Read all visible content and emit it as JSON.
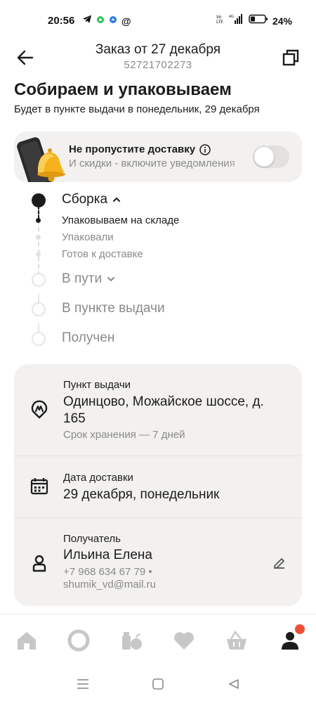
{
  "status_bar": {
    "time": "20:56",
    "battery": "24%",
    "icons_left": [
      "telegram-icon",
      "green-dot-icon",
      "blue-app-icon",
      "at-icon"
    ],
    "icons_right": [
      "volte-icon",
      "signal-icon",
      "battery-icon"
    ]
  },
  "header": {
    "title": "Заказ от 27 декабря",
    "order_number": "52721702273"
  },
  "status": {
    "heading": "Собираем и упаковываем",
    "subheading": "Будет в пункте выдачи в понедельник, 29 декабря"
  },
  "notification": {
    "title": "Не пропустите доставку",
    "text": "И скидки - включите уведомления",
    "toggle_on": false
  },
  "timeline": {
    "steps": [
      {
        "label": "Сборка",
        "state": "active",
        "expanded": true
      },
      {
        "label": "В пути",
        "state": "pending",
        "expanded": false
      },
      {
        "label": "В пункте выдачи",
        "state": "pending"
      },
      {
        "label": "Получен",
        "state": "pending"
      }
    ],
    "substeps": [
      {
        "label": "Упаковываем на складе",
        "state": "active"
      },
      {
        "label": "Упаковали",
        "state": "pending"
      },
      {
        "label": "Готов к доставке",
        "state": "pending"
      }
    ]
  },
  "details": {
    "pickup": {
      "label": "Пункт выдачи",
      "address": "Одинцово, Можайское шоссе, д. 165",
      "storage_note": "Срок хранения — 7 дней"
    },
    "delivery": {
      "label": "Дата доставки",
      "date": "29 декабря, понедельник"
    },
    "recipient": {
      "label": "Получатель",
      "name": "Ильина Елена",
      "phone": "+7 968 634 67 79 •",
      "email": "shumik_vd@mail.ru"
    }
  },
  "bottom_nav": {
    "items": [
      "home-icon",
      "alice-icon",
      "catalog-icon",
      "favorites-icon",
      "cart-icon",
      "profile-icon"
    ],
    "profile_has_badge": true
  },
  "colors": {
    "text": "#1c1c1c",
    "muted": "#8a8a8a",
    "card_bg": "#f2f1ef",
    "nav_icon": "#c7c7c7",
    "badge": "#f04e35"
  }
}
